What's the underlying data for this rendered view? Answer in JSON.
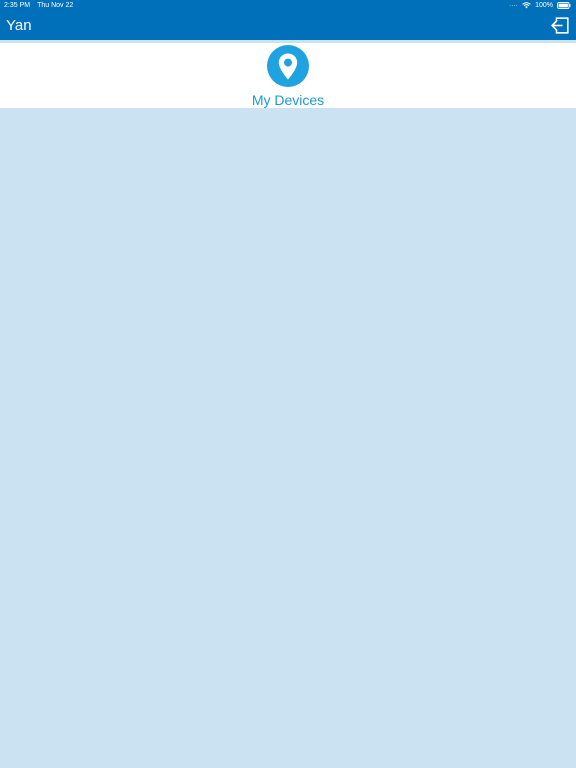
{
  "status_bar": {
    "time": "2:35 PM",
    "date": "Thu Nov 22",
    "signal": "....",
    "battery_percent": "100%",
    "battery_level": 1.0
  },
  "header": {
    "title": "Yan",
    "logout_icon": "logout-icon"
  },
  "menu": {
    "items": [
      {
        "label": "My Devices",
        "icon": "location-pin-icon"
      }
    ]
  },
  "colors": {
    "header_bg": "#0070bb",
    "accent": "#1fa3e0",
    "label": "#1c9ad6",
    "content_bg": "#cbe2f2",
    "panel_bg": "#ffffff"
  }
}
